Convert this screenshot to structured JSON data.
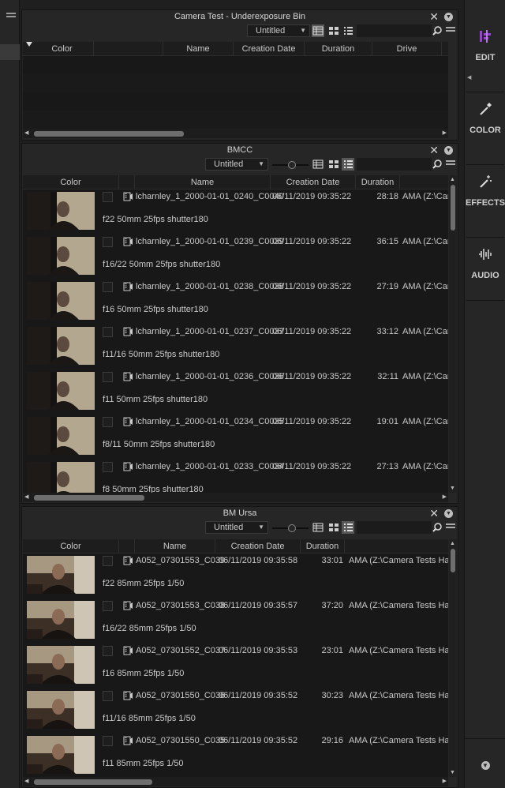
{
  "colors": {
    "accent": "#9b3fd9",
    "panel_bg": "#262626",
    "content_bg": "#181818"
  },
  "sidebar": {
    "items": [
      {
        "label": "EDIT",
        "icon": "edit-icon"
      },
      {
        "label": "COLOR",
        "icon": "eyedropper-icon"
      },
      {
        "label": "EFFECTS",
        "icon": "magic-wand-icon"
      },
      {
        "label": "AUDIO",
        "icon": "waveform-icon"
      }
    ]
  },
  "bin1": {
    "title": "Camera Test - Underexposure Bin",
    "view": "Untitled",
    "columns": [
      "Color",
      "Name",
      "Creation Date",
      "Duration",
      "Drive"
    ]
  },
  "bin2": {
    "title": "BMCC",
    "view": "Untitled",
    "columns": [
      "Color",
      "Name",
      "Creation Date",
      "Duration"
    ],
    "rows": [
      {
        "name": "lcharnley_1_2000-01-01_0240_C0040",
        "date": "06/11/2019 09:35:22",
        "duration": "28:18",
        "drive": "AMA (Z:\\Cam",
        "comment": "f22  50mm  25fps shutter180"
      },
      {
        "name": "lcharnley_1_2000-01-01_0239_C0039",
        "date": "06/11/2019 09:35:22",
        "duration": "36:15",
        "drive": "AMA (Z:\\Cam",
        "comment": "f16/22 50mm  25fps shutter180"
      },
      {
        "name": "lcharnley_1_2000-01-01_0238_C0038",
        "date": "06/11/2019 09:35:22",
        "duration": "27:19",
        "drive": "AMA (Z:\\Cam",
        "comment": "f16 50mm  25fps shutter180"
      },
      {
        "name": "lcharnley_1_2000-01-01_0237_C0037",
        "date": "06/11/2019 09:35:22",
        "duration": "33:12",
        "drive": "AMA (Z:\\Cam",
        "comment": "f11/16 50mm  25fps shutter180"
      },
      {
        "name": "lcharnley_1_2000-01-01_0236_C0036",
        "date": "06/11/2019 09:35:22",
        "duration": "32:11",
        "drive": "AMA (Z:\\Cam",
        "comment": "f11 50mm  25fps shutter180"
      },
      {
        "name": "lcharnley_1_2000-01-01_0234_C0035",
        "date": "06/11/2019 09:35:22",
        "duration": "19:01",
        "drive": "AMA (Z:\\Cam",
        "comment": "f8/11 50mm  25fps shutter180"
      },
      {
        "name": "lcharnley_1_2000-01-01_0233_C0034",
        "date": "06/11/2019 09:35:22",
        "duration": "27:13",
        "drive": "AMA (Z:\\Cam",
        "comment": "f8  50mm  25fps shutter180"
      }
    ]
  },
  "bin3": {
    "title": "BM Ursa",
    "view": "Untitled",
    "columns": [
      "Color",
      "Name",
      "Creation Date",
      "Duration"
    ],
    "rows": [
      {
        "name": "A052_07301553_C039",
        "date": "06/11/2019 09:35:58",
        "duration": "33:01",
        "drive": "AMA (Z:\\Camera Tests Hann",
        "comment": "f22  85mm  25fps 1/50"
      },
      {
        "name": "A052_07301553_C038",
        "date": "06/11/2019 09:35:57",
        "duration": "37:20",
        "drive": "AMA (Z:\\Camera Tests Hann",
        "comment": "f16/22  85mm  25fps 1/50"
      },
      {
        "name": "A052_07301552_C037",
        "date": "06/11/2019 09:35:53",
        "duration": "23:01",
        "drive": "AMA (Z:\\Camera Tests Hann",
        "comment": "f16 85mm  25fps 1/50"
      },
      {
        "name": "A052_07301550_C036",
        "date": "06/11/2019 09:35:52",
        "duration": "30:23",
        "drive": "AMA (Z:\\Camera Tests Hann",
        "comment": "f11/16  85mm  25fps 1/50"
      },
      {
        "name": "A052_07301550_C035",
        "date": "06/11/2019 09:35:52",
        "duration": "29:16",
        "drive": "AMA (Z:\\Camera Tests Hann",
        "comment": "f11  85mm  25fps 1/50"
      }
    ]
  }
}
